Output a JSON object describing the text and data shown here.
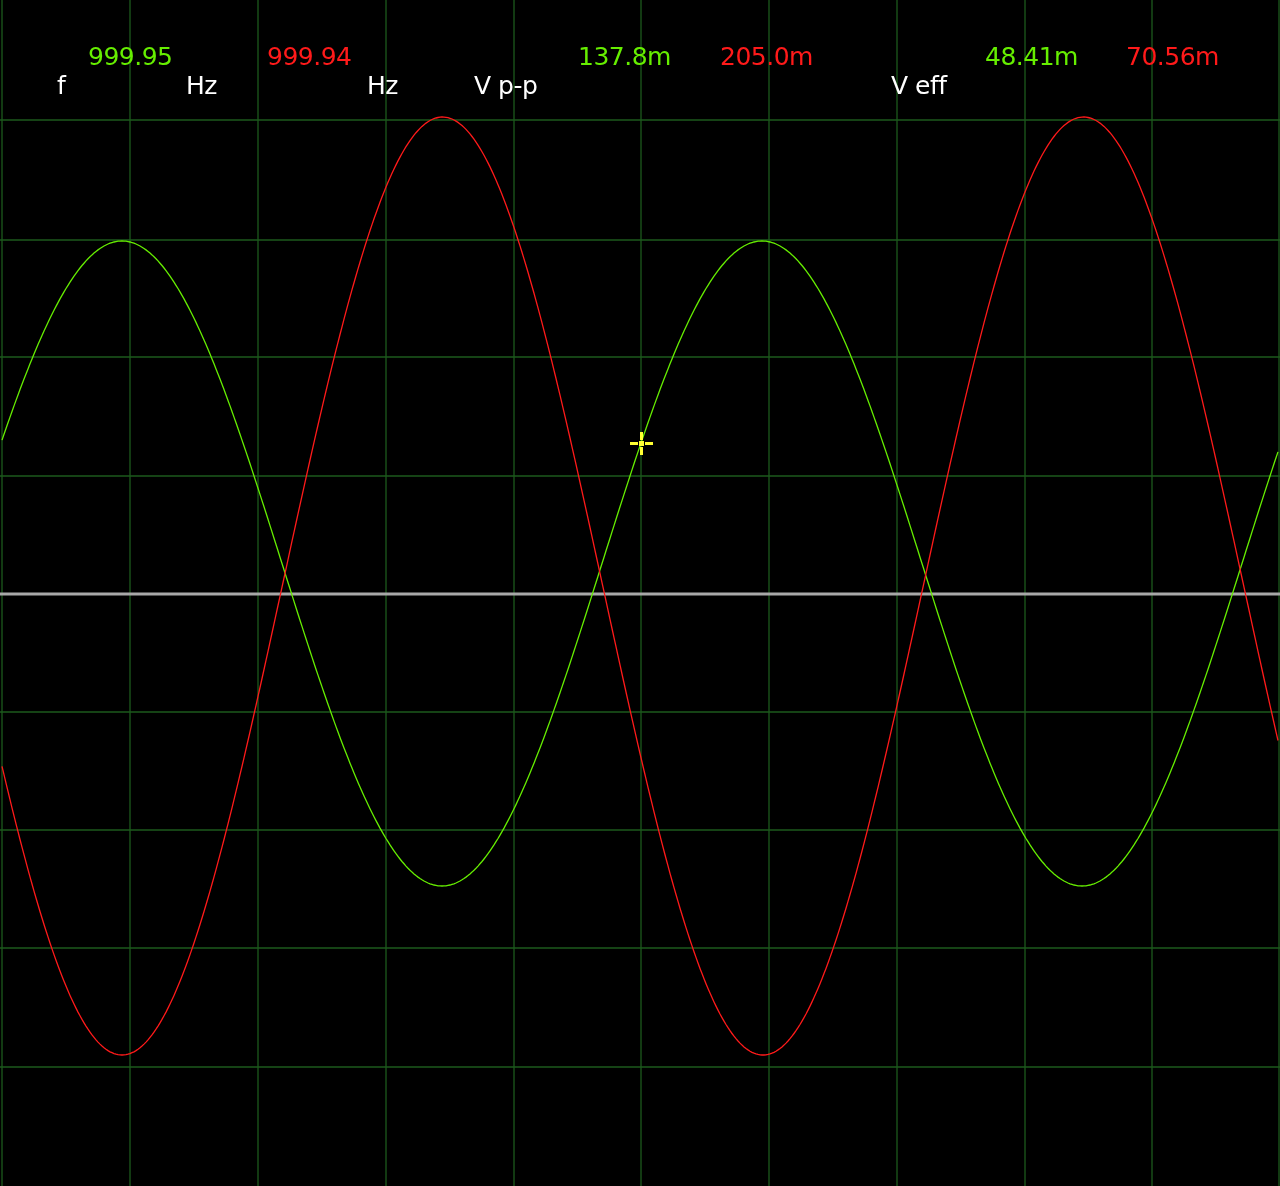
{
  "traces": [
    {
      "color": "#66ee00"
    },
    {
      "color": "#ff1a1a"
    }
  ],
  "readouts": [
    {
      "label": "f",
      "values": [
        {
          "value": "999.95",
          "unit": "Hz",
          "color": "#66ee00"
        },
        {
          "value": "999.94",
          "unit": "Hz",
          "color": "#ff1a1a"
        }
      ]
    },
    {
      "label": "V p-p",
      "values": [
        {
          "value": "137.8m",
          "color": "#66ee00"
        },
        {
          "value": "205.0m",
          "color": "#ff1a1a"
        }
      ]
    },
    {
      "label": "V eff",
      "values": [
        {
          "value": "48.41m",
          "color": "#66ee00"
        },
        {
          "value": "70.56m",
          "color": "#ff1a1a"
        }
      ]
    }
  ]
}
